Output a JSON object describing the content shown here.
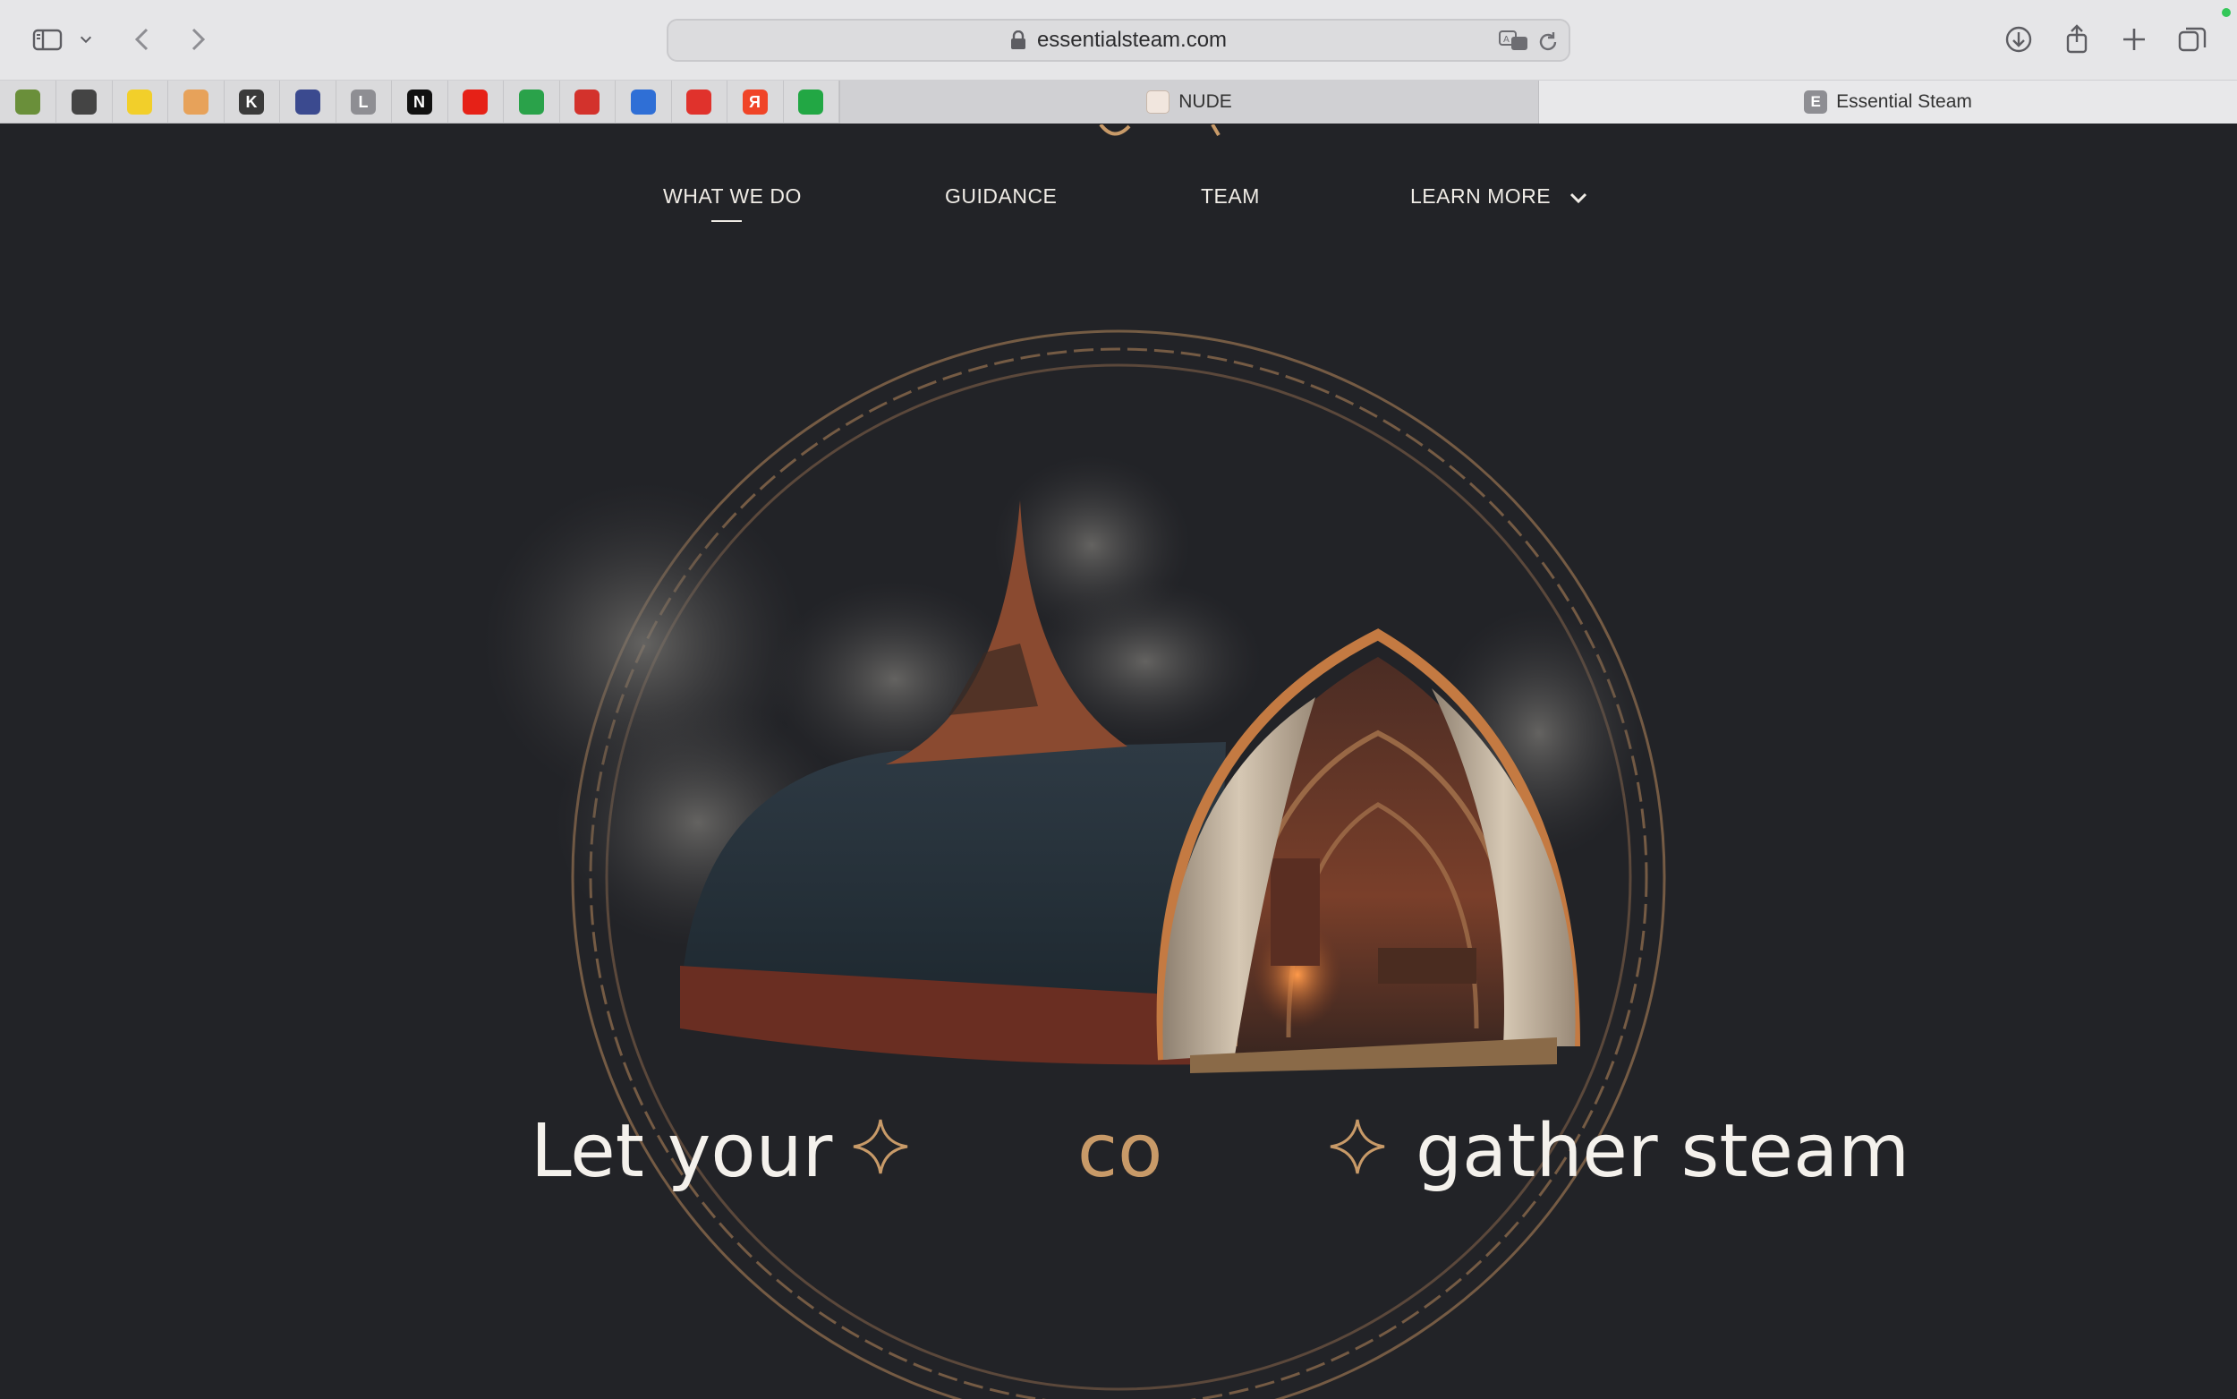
{
  "browser": {
    "url": "essentialsteam.com",
    "tabs": [
      {
        "title": "NUDE",
        "active": false
      },
      {
        "title": "Essential Steam",
        "active": true,
        "icon_letter": "E"
      }
    ],
    "favorites": [
      {
        "name": "fav-1",
        "glyph": "",
        "color": "#6a8f3a"
      },
      {
        "name": "fav-2",
        "glyph": "",
        "color": "#444444"
      },
      {
        "name": "fav-3",
        "glyph": "",
        "color": "#f2cf2a"
      },
      {
        "name": "fav-4",
        "glyph": "",
        "color": "#e7a25a"
      },
      {
        "name": "fav-5",
        "glyph": "K",
        "color": "#3a3a3a"
      },
      {
        "name": "fav-6",
        "glyph": "",
        "color": "#3b4a8f"
      },
      {
        "name": "fav-7",
        "glyph": "L",
        "color": "#8e8e93"
      },
      {
        "name": "fav-8",
        "glyph": "N",
        "color": "#111111"
      },
      {
        "name": "fav-9",
        "glyph": "",
        "color": "#e62117"
      },
      {
        "name": "fav-10",
        "glyph": "",
        "color": "#2aa24a"
      },
      {
        "name": "fav-11",
        "glyph": "",
        "color": "#d3322c"
      },
      {
        "name": "fav-12",
        "glyph": "",
        "color": "#2f6fd6"
      },
      {
        "name": "fav-13",
        "glyph": "",
        "color": "#e0322c"
      },
      {
        "name": "fav-14",
        "glyph": "Я",
        "color": "#f04427"
      },
      {
        "name": "fav-15",
        "glyph": "",
        "color": "#22a744"
      }
    ]
  },
  "nav": {
    "items": [
      {
        "label": "WHAT WE DO",
        "active": true
      },
      {
        "label": "GUIDANCE"
      },
      {
        "label": "TEAM"
      },
      {
        "label": "LEARN MORE",
        "has_dropdown": true
      }
    ]
  },
  "hero": {
    "headline_start": "Let your",
    "headline_accent": "co",
    "headline_end": "gather steam"
  },
  "colors": {
    "page_bg": "#222327",
    "accent": "#c89a68",
    "text": "#f4f1ec"
  }
}
